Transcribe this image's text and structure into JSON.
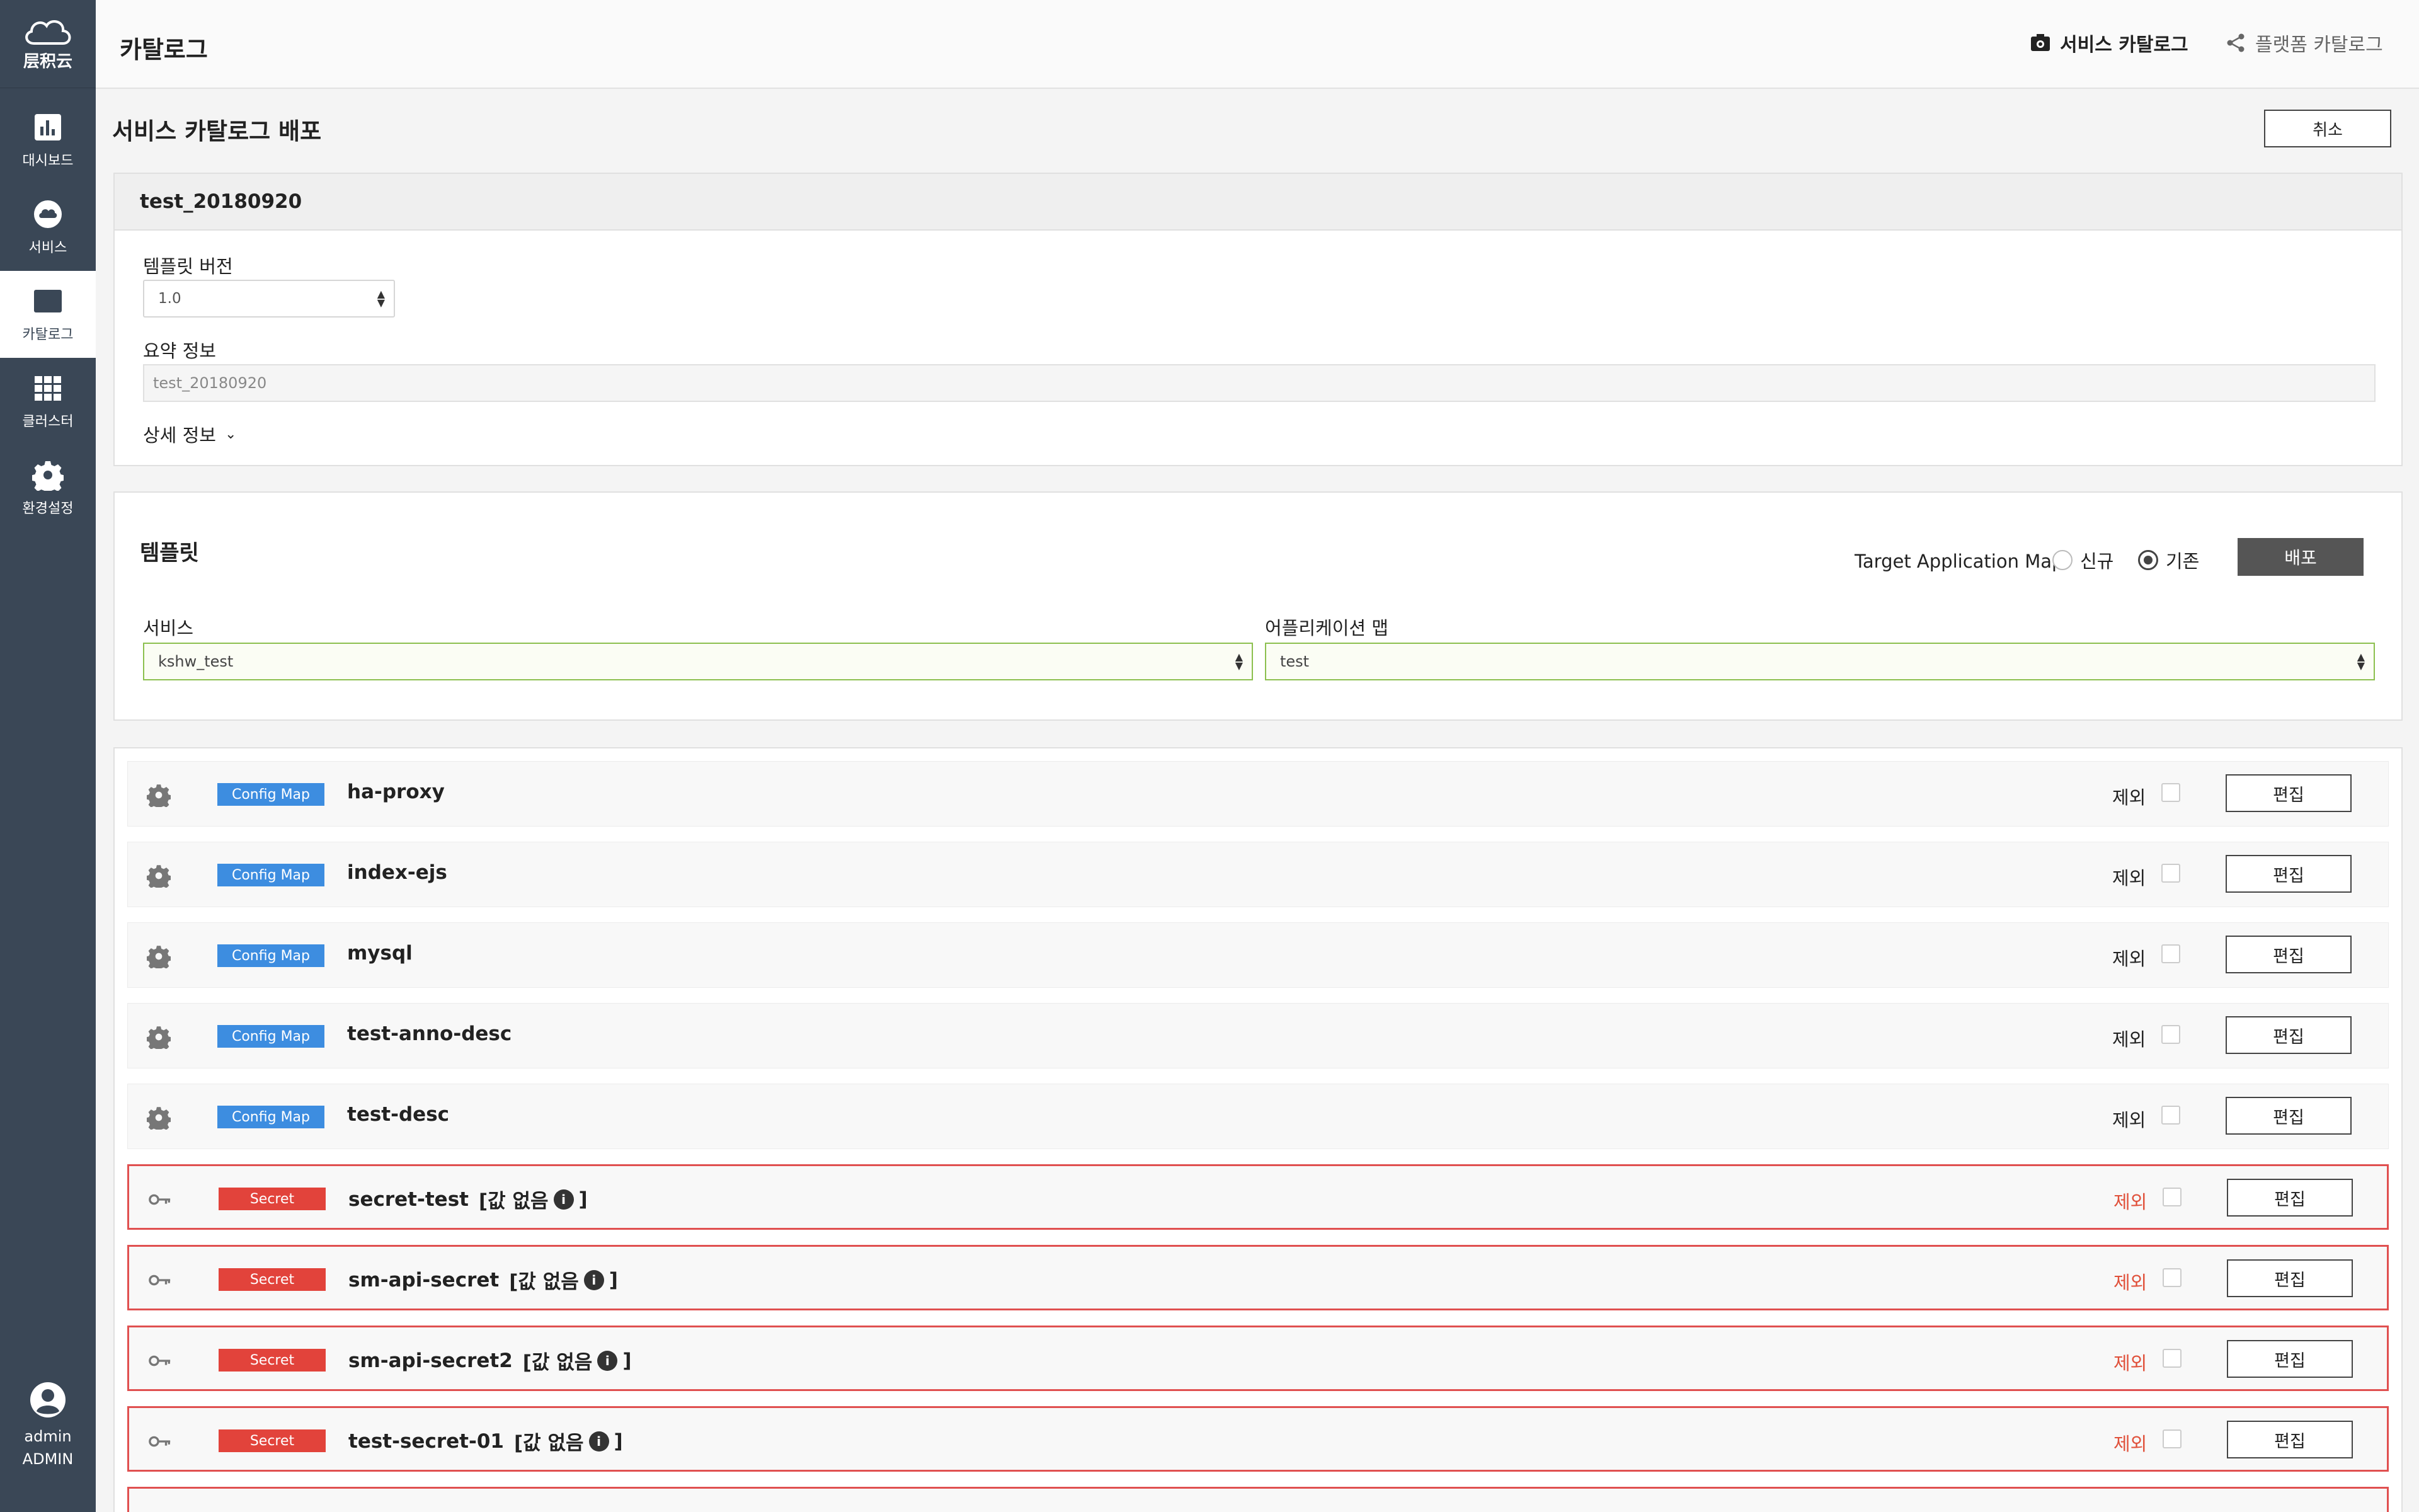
{
  "brand": {
    "name": "层积云"
  },
  "nav": [
    {
      "label": "대시보드",
      "icon": "bar-chart-icon"
    },
    {
      "label": "서비스",
      "icon": "cloud-icon"
    },
    {
      "label": "카탈로그",
      "icon": "catalog-icon",
      "active": true
    },
    {
      "label": "클러스터",
      "icon": "grid-icon"
    },
    {
      "label": "환경설정",
      "icon": "gear-icon"
    }
  ],
  "user": {
    "name": "admin",
    "role": "ADMIN"
  },
  "header": {
    "title": "카탈로그",
    "service_catalog": "서비스 카탈로그",
    "platform_catalog": "플랫폼 카탈로그"
  },
  "deploy": {
    "title": "서비스 카탈로그 배포",
    "cancel_label": "취소"
  },
  "info": {
    "name": "test_20180920",
    "version_label": "템플릿 버전",
    "version_value": "1.0",
    "summary_label": "요약 정보",
    "summary_value": "test_20180920",
    "detail_label": "상세 정보"
  },
  "template": {
    "title": "템플릿",
    "target_label": "Target Application Map",
    "radio_new": "신규",
    "radio_existing": "기존",
    "selected_radio": "기존",
    "deploy_label": "배포",
    "service_label": "서비스",
    "service_value": "kshw_test",
    "appmap_label": "어플리케이션 맵",
    "appmap_value": "test"
  },
  "resources": {
    "exclude_label": "제외",
    "edit_label": "편집",
    "no_value_label": "[값 없음",
    "no_value_close": "]",
    "rows": [
      {
        "type": "Config Map",
        "name": "ha-proxy",
        "kind": "cm"
      },
      {
        "type": "Config Map",
        "name": "index-ejs",
        "kind": "cm"
      },
      {
        "type": "Config Map",
        "name": "mysql",
        "kind": "cm"
      },
      {
        "type": "Config Map",
        "name": "test-anno-desc",
        "kind": "cm"
      },
      {
        "type": "Config Map",
        "name": "test-desc",
        "kind": "cm"
      },
      {
        "type": "Secret",
        "name": "secret-test",
        "kind": "sec"
      },
      {
        "type": "Secret",
        "name": "sm-api-secret",
        "kind": "sec"
      },
      {
        "type": "Secret",
        "name": "sm-api-secret2",
        "kind": "sec"
      },
      {
        "type": "Secret",
        "name": "test-secret-01",
        "kind": "sec"
      }
    ]
  },
  "colors": {
    "sidebar": "#3a4756",
    "config_map_badge": "#3d8de0",
    "secret_badge": "#e2433b",
    "valid_select_border": "#8cc04f"
  }
}
